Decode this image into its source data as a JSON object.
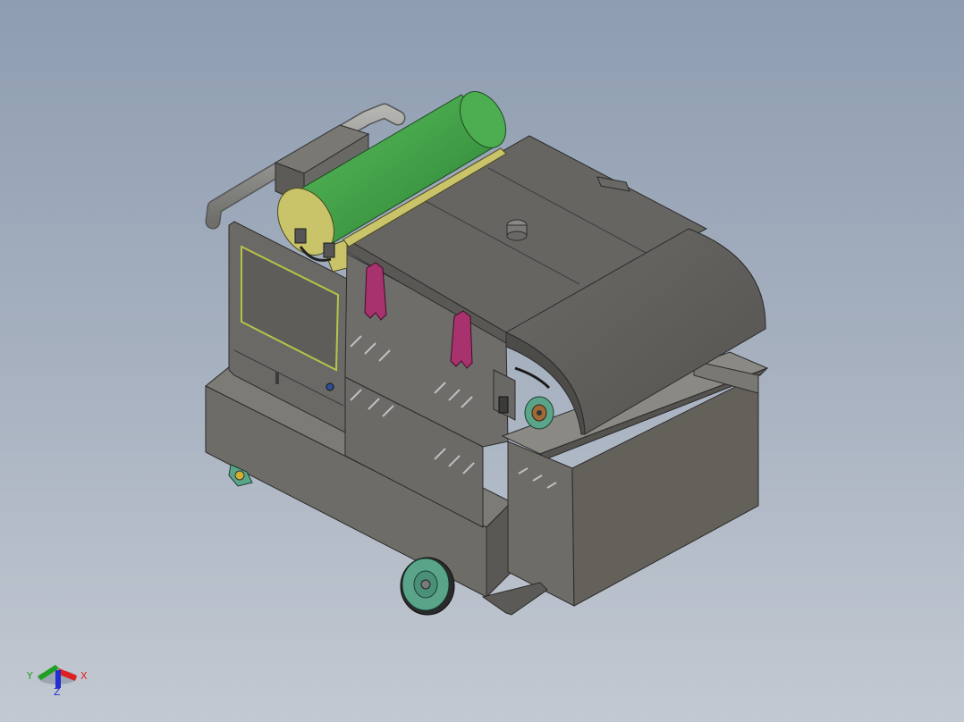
{
  "viewport": {
    "background_top": "#8e9db1",
    "background_bottom": "#c3c9d2"
  },
  "model": {
    "body_color": "#6e6c67",
    "drum_color": "#3e9a44",
    "drum_end_color": "#c9c36a",
    "clip_color": "#a8326e",
    "wheel_color": "#5aa58a",
    "edge_color": "#2b2b2b"
  },
  "triad": {
    "x_label": "X",
    "y_label": "Y",
    "z_label": "Z",
    "x_color": "#e02020",
    "y_color": "#1fa01f",
    "z_color": "#2030d0"
  }
}
